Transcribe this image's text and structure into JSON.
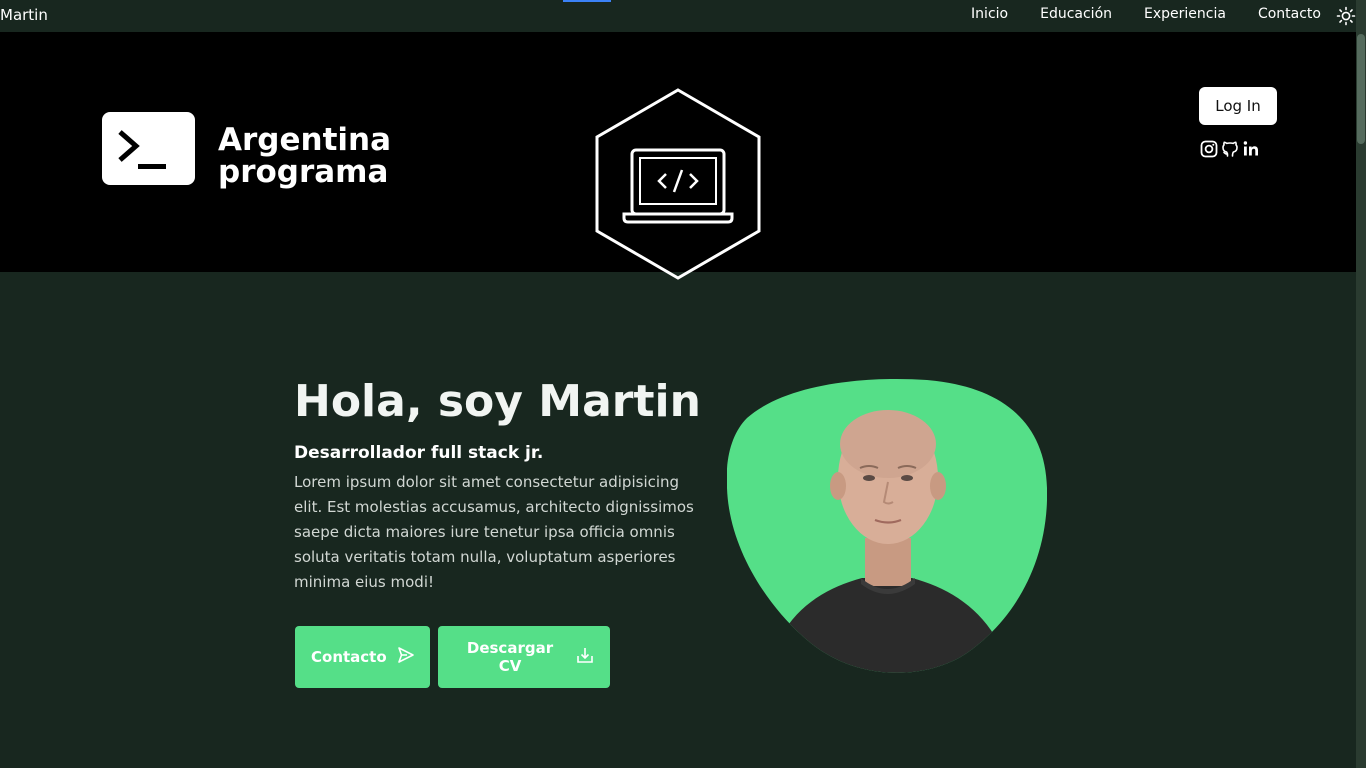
{
  "nav": {
    "brand": "Martin",
    "links": [
      "Inicio",
      "Educación",
      "Experiencia",
      "Contacto"
    ],
    "theme_toggle_icon": "sun-icon"
  },
  "banner": {
    "logo_text_line1": "Argentina",
    "logo_text_line2": "programa",
    "logo_icon": "terminal-prompt-icon",
    "hex_icon": "laptop-code-icon",
    "login_label": "Log In",
    "social_icons": [
      "instagram-icon",
      "github-icon",
      "linkedin-icon"
    ]
  },
  "hero": {
    "title": "Hola, soy Martin",
    "subtitle": "Desarrollador full stack jr.",
    "description": "Lorem ipsum dolor sit amet consectetur adipisicing elit. Est molestias accusamus, architecto dignissimos saepe dicta maiores iure tenetur ipsa officia omnis soluta veritatis totam nulla, voluptatum asperiores minima eius modi!",
    "contact_label": "Contacto",
    "cv_label": "Descargar CV"
  },
  "colors": {
    "background": "#18271f",
    "accent": "#55df88",
    "banner": "#000000"
  }
}
